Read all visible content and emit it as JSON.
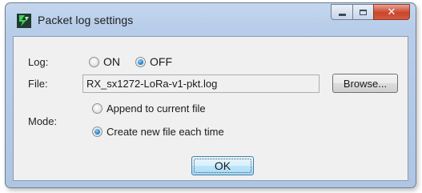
{
  "window": {
    "title": "Packet log settings",
    "icon": "packet-logger-app-icon",
    "caption_buttons": [
      "minimize-icon",
      "maximize-icon",
      "close-icon"
    ],
    "close_glyph": "✕"
  },
  "log": {
    "label": "Log:",
    "options": [
      "ON",
      "OFF"
    ],
    "selected": "OFF"
  },
  "file": {
    "label": "File:",
    "value": "RX_sx1272-LoRa-v1-pkt.log",
    "browse_label": "Browse..."
  },
  "mode": {
    "label": "Mode:",
    "options": [
      "Append to current file",
      "Create new file each time"
    ],
    "selected": "Create new file each time"
  },
  "ok_label": "OK",
  "colors": {
    "title_bar": "#b8cde9",
    "dialog_body": "#f0f0f0",
    "close_button": "#c9462c",
    "radio_selected": "#2a8ad4",
    "default_button_border": "#3c7fb1"
  }
}
